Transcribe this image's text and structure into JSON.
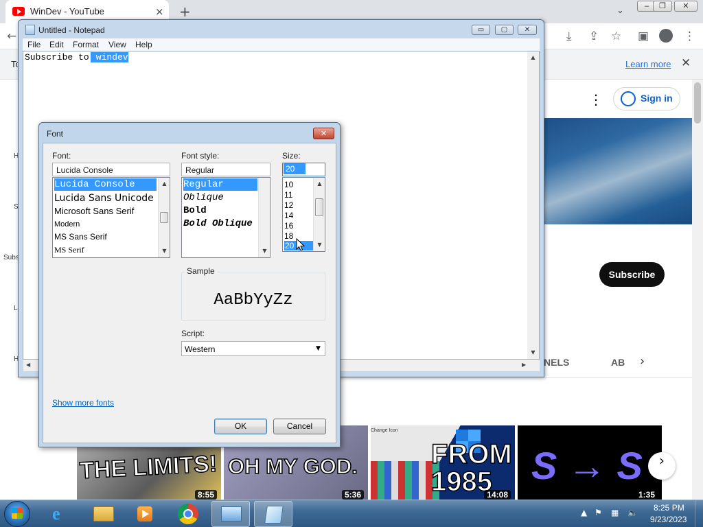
{
  "browser": {
    "tab_title": "WinDev - YouTube",
    "close_glyph": "×",
    "new_tab_glyph": "+",
    "dropdown_glyph": "⌄",
    "infobar_start": "To",
    "learn_more": "Learn more",
    "infobar_close": "✕",
    "icons": [
      "download-icon",
      "share-icon",
      "star-icon",
      "sidebar-icon",
      "profile-icon",
      "menu-icon"
    ]
  },
  "youtube": {
    "more_glyph": "⋮",
    "sign_in": "Sign in",
    "subscribe": "Subscribe",
    "tab_channels": "NELS",
    "tab_about": "AB",
    "tabs_next": "›",
    "side_letters": [
      "H",
      "S",
      "Subs",
      "L",
      "H"
    ],
    "thumbnails": [
      {
        "caption": "THE LIMITS!",
        "duration": "8:55",
        "bg": "#7c7c7c"
      },
      {
        "caption": "OH MY GOD.",
        "duration": "5:36",
        "bg": "#8d8aa3"
      },
      {
        "caption": "FROM 1985",
        "duration": "14:08",
        "bg": "#0b2b6e",
        "dialog_title": "Change Icon"
      },
      {
        "caption": "S → S",
        "duration": "1:35",
        "bg": "#000000"
      }
    ],
    "next_glyph": "›"
  },
  "notepad": {
    "title": "Untitled - Notepad",
    "controls": [
      "▭",
      "▢",
      "✕"
    ],
    "menu": [
      "File",
      "Edit",
      "Format",
      "View",
      "Help"
    ],
    "text_plain": "Subscribe to",
    "text_selected": " windev"
  },
  "font_dialog": {
    "title": "Font",
    "close_glyph": "✕",
    "font_label": "Font:",
    "font_value": "Lucida Console",
    "fonts": [
      {
        "name": "Lucida Console",
        "selected": true
      },
      {
        "name": "Lucida Sans Unicode",
        "selected": false
      },
      {
        "name": "Microsoft Sans Serif",
        "selected": false
      },
      {
        "name": "Modern",
        "selected": false
      },
      {
        "name": "MS Sans Serif",
        "selected": false
      },
      {
        "name": "MS Serif",
        "selected": false
      }
    ],
    "style_label": "Font style:",
    "style_value": "Regular",
    "styles": [
      {
        "name": "Regular",
        "selected": true
      },
      {
        "name": "Oblique",
        "selected": false
      },
      {
        "name": "Bold",
        "selected": false
      },
      {
        "name": "Bold Oblique",
        "selected": false
      }
    ],
    "size_label": "Size:",
    "size_value": "20",
    "sizes": [
      "10",
      "11",
      "12",
      "14",
      "16",
      "18",
      "20"
    ],
    "selected_size": "20",
    "sample_label": "Sample",
    "sample_text": "AaBbYyZz",
    "script_label": "Script:",
    "script_value": "Western",
    "show_more": "Show more fonts",
    "ok": "OK",
    "cancel": "Cancel"
  },
  "taskbar": {
    "apps": [
      "start-orb",
      "internet-explorer",
      "file-explorer",
      "media-player",
      "chrome",
      "control-panel",
      "notepad"
    ],
    "clock_time": "8:25 PM",
    "clock_date": "9/23/2023"
  },
  "colors": {
    "selection": "#3399ff",
    "yt_red": "#ff0000",
    "link": "#0066cc",
    "taskbar": "#3f6a94"
  }
}
